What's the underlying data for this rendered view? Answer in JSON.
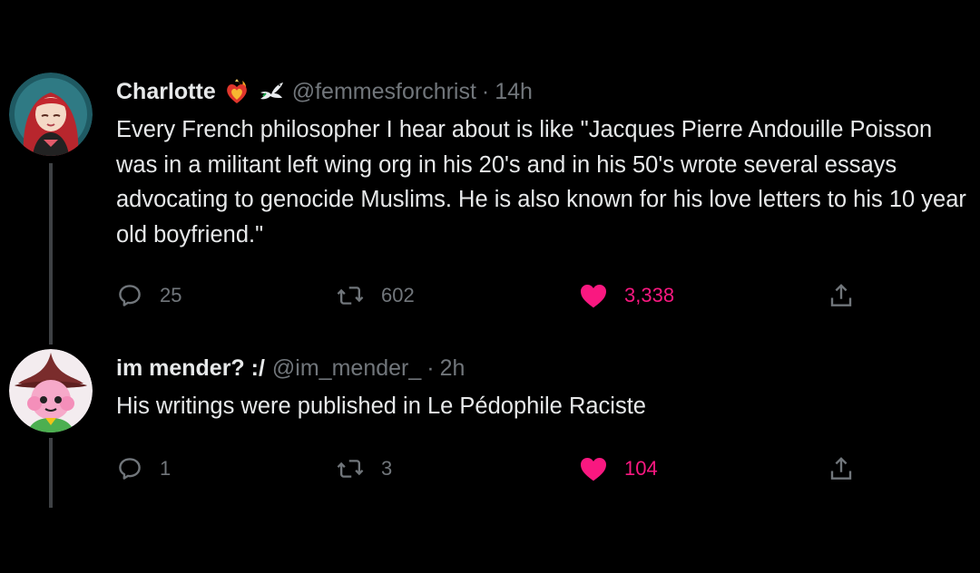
{
  "tweets": [
    {
      "author_name": "Charlotte",
      "handle": "@femmesforchrist",
      "separator": "·",
      "time": "14h",
      "text": "Every French philosopher I hear about is like \"Jacques Pierre Andouille Poisson was in a militant left wing org in his 20's and in his 50's wrote several essays advocating to genocide Muslims. He is also known for his love letters to his 10 year old boyfriend.\"",
      "badges": [
        "sacred-heart-flame-icon",
        "dove-icon"
      ],
      "replies": "25",
      "retweets": "602",
      "likes": "3,338",
      "liked": true
    },
    {
      "author_name": "im mender? :/",
      "handle": "@im_mender_",
      "separator": "·",
      "time": "2h",
      "text": "His writings were published in Le Pédophile Raciste",
      "badges": [],
      "replies": "1",
      "retweets": "3",
      "likes": "104",
      "liked": true
    }
  ],
  "icons": {
    "reply": "speech-bubble-icon",
    "retweet": "retweet-arrows-icon",
    "like": "heart-icon",
    "share": "share-upload-icon"
  },
  "colors": {
    "background": "#000000",
    "text": "#e7e9ea",
    "muted": "#71767b",
    "like": "#f91880",
    "thread_line": "#3e4144"
  }
}
